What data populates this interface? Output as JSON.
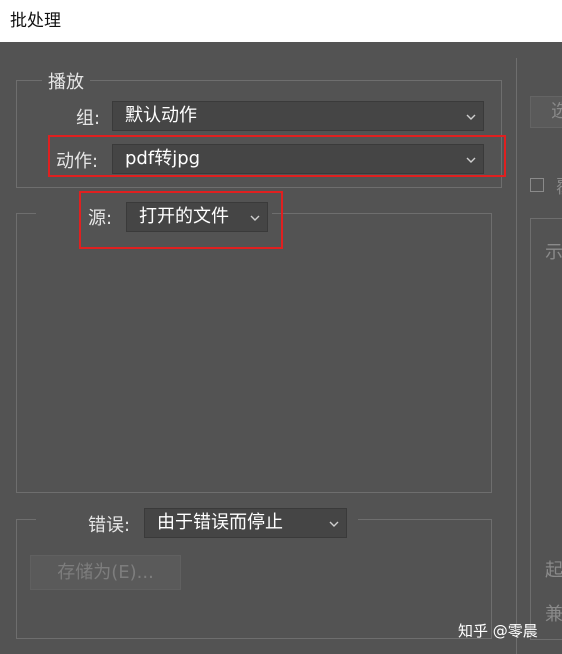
{
  "window": {
    "title": "批处理"
  },
  "play": {
    "legend": "播放",
    "group_label": "组:",
    "group_value": "默认动作",
    "action_label": "动作:",
    "action_value": "pdf转jpg"
  },
  "source": {
    "label": "源:",
    "value": "打开的文件"
  },
  "error": {
    "label": "错误:",
    "value": "由于错误而停止",
    "save_as_label": "存储为(E)..."
  },
  "right_panel": {
    "button_label": "选",
    "checkbox_label": "覆",
    "group_text": "示",
    "start_text": "起",
    "compat_text": "兼"
  },
  "watermark": "知乎 @零晨",
  "colors": {
    "highlight": "#e02020",
    "panel_bg": "#535353",
    "dropdown_bg": "#454545"
  },
  "icons": {
    "dropdown_chevron": "chevron-down-icon"
  }
}
